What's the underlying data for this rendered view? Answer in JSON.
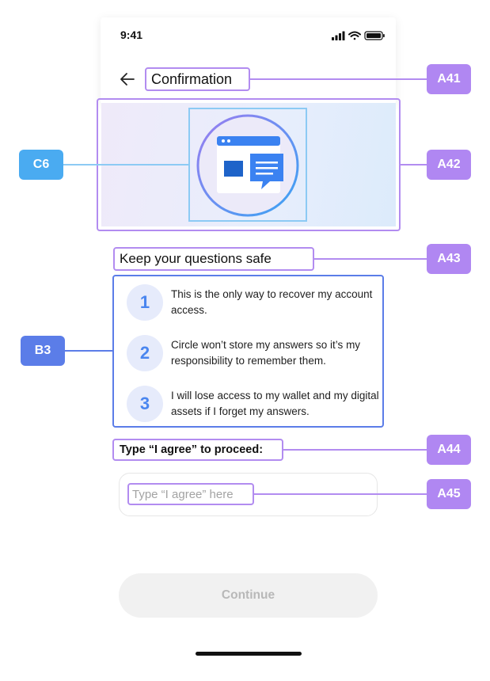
{
  "status_bar": {
    "time": "9:41"
  },
  "header": {
    "title": "Confirmation",
    "back_icon": "arrow-left-icon"
  },
  "hero": {
    "illustration_icon": "chat-window-icon"
  },
  "section": {
    "heading": "Keep your questions safe",
    "items": [
      {
        "number": "1",
        "text": "This is the only way to recover my account access."
      },
      {
        "number": "2",
        "text": "Circle won’t store my answers so it’s my responsibility to remember them."
      },
      {
        "number": "3",
        "text": "I will lose access to my wallet and my digital assets if I forget my answers."
      }
    ]
  },
  "agreement": {
    "label": "Type “I agree” to proceed:",
    "placeholder": "Type “I agree” here"
  },
  "footer": {
    "continue_label": "Continue"
  },
  "annotations": {
    "A41": "A41",
    "A42": "A42",
    "A43": "A43",
    "A44": "A44",
    "A45": "A45",
    "B3": "B3",
    "C6": "C6"
  },
  "colors": {
    "annotation_purple": "#b087f2",
    "annotation_blue": "#5b7de8",
    "annotation_cyan": "#4aabf1",
    "accent_number": "#4a86ef",
    "button_disabled_bg": "#f1f1f1",
    "button_disabled_text": "#b8b8b8"
  }
}
